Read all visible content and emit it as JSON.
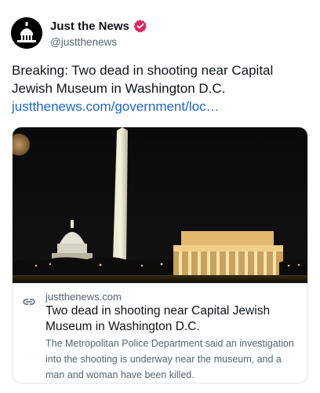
{
  "post": {
    "author_name": "Just the News",
    "handle": "@justthenews",
    "text": "Breaking: Two dead in shooting near Capital Jewish Museum in Washington D.C.",
    "link_text": "justthenews.com/government/loc…"
  },
  "card": {
    "domain": "justthenews.com",
    "title": "Two dead in shooting near Capital Jewish Museum in Washington D.C.",
    "description": "The Metropolitan Police Department said an investigation into the shooting is underway near the museum, and a man and woman have been killed."
  },
  "colors": {
    "link": "#1d66d8",
    "verified_badge": "#e0245e",
    "secondary_text": "#536471"
  },
  "icons": {
    "verified": "verified-badge-icon",
    "link": "link-icon"
  }
}
